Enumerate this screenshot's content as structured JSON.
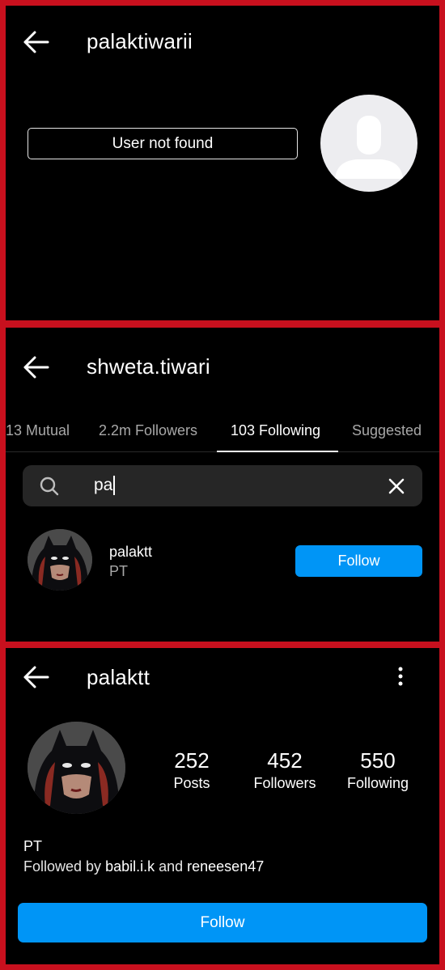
{
  "panel1": {
    "title": "palaktiwarii",
    "message": "User not found"
  },
  "panel2": {
    "title": "shweta.tiwari",
    "tabs": [
      {
        "label": "13 Mutual"
      },
      {
        "label": "2.2m Followers"
      },
      {
        "label": "103 Following"
      },
      {
        "label": "Suggested"
      }
    ],
    "active_tab": "103 Following",
    "search": {
      "value": "pa"
    },
    "result": {
      "username": "palaktt",
      "full_name": "PT",
      "follow_label": "Follow"
    }
  },
  "panel3": {
    "title": "palaktt",
    "stats": [
      {
        "value": "252",
        "label": "Posts"
      },
      {
        "value": "452",
        "label": "Followers"
      },
      {
        "value": "550",
        "label": "Following"
      }
    ],
    "bio_name": "PT",
    "followed_by": {
      "prefix": "Followed by ",
      "user1": "babil.i.k",
      "joiner": " and ",
      "user2": "reneesen47"
    },
    "follow_label": "Follow"
  },
  "colors": {
    "accent": "#0095f6",
    "frame": "#c8101e",
    "background": "#000000"
  },
  "icons": [
    "back-arrow-icon",
    "search-icon",
    "close-icon",
    "more-vertical-icon"
  ]
}
